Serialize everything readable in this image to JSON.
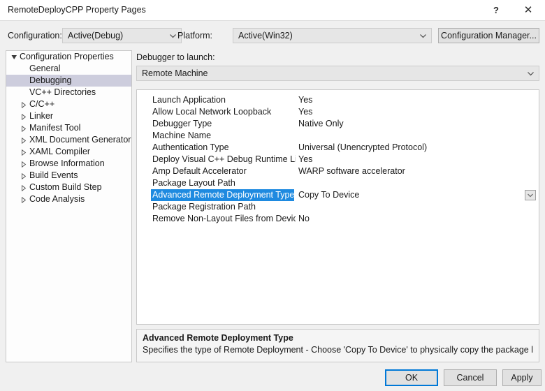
{
  "window": {
    "title": "RemoteDeployCPP Property Pages",
    "help_glyph": "?",
    "close_glyph": "✕"
  },
  "toolbar": {
    "configuration_label": "Configuration:",
    "configuration_value": "Active(Debug)",
    "platform_label": "Platform:",
    "platform_value": "Active(Win32)",
    "config_manager_label": "Configuration Manager..."
  },
  "tree": {
    "items": [
      {
        "label": "Configuration Properties",
        "level": "root",
        "expander": "expanded",
        "selected": false
      },
      {
        "label": "General",
        "level": "child",
        "expander": "none",
        "selected": false
      },
      {
        "label": "Debugging",
        "level": "child",
        "expander": "none",
        "selected": true
      },
      {
        "label": "VC++ Directories",
        "level": "child",
        "expander": "none",
        "selected": false
      },
      {
        "label": "C/C++",
        "level": "group",
        "expander": "collapsed",
        "selected": false
      },
      {
        "label": "Linker",
        "level": "group",
        "expander": "collapsed",
        "selected": false
      },
      {
        "label": "Manifest Tool",
        "level": "group",
        "expander": "collapsed",
        "selected": false
      },
      {
        "label": "XML Document Generator",
        "level": "group",
        "expander": "collapsed",
        "selected": false
      },
      {
        "label": "XAML Compiler",
        "level": "group",
        "expander": "collapsed",
        "selected": false
      },
      {
        "label": "Browse Information",
        "level": "group",
        "expander": "collapsed",
        "selected": false
      },
      {
        "label": "Build Events",
        "level": "group",
        "expander": "collapsed",
        "selected": false
      },
      {
        "label": "Custom Build Step",
        "level": "group",
        "expander": "collapsed",
        "selected": false
      },
      {
        "label": "Code Analysis",
        "level": "group",
        "expander": "collapsed",
        "selected": false
      }
    ]
  },
  "main": {
    "debugger_label": "Debugger to launch:",
    "debugger_value": "Remote Machine",
    "properties": [
      {
        "name": "Launch Application",
        "value": "Yes",
        "selected": false
      },
      {
        "name": "Allow Local Network Loopback",
        "value": "Yes",
        "selected": false
      },
      {
        "name": "Debugger Type",
        "value": "Native Only",
        "selected": false
      },
      {
        "name": "Machine Name",
        "value": "",
        "selected": false
      },
      {
        "name": "Authentication Type",
        "value": "Universal (Unencrypted Protocol)",
        "selected": false
      },
      {
        "name": "Deploy Visual C++ Debug Runtime Librari",
        "value": "Yes",
        "selected": false
      },
      {
        "name": "Amp Default Accelerator",
        "value": "WARP software accelerator",
        "selected": false
      },
      {
        "name": "Package Layout Path",
        "value": "",
        "selected": false
      },
      {
        "name": "Advanced Remote Deployment Type",
        "value": "Copy To Device",
        "selected": true
      },
      {
        "name": "Package Registration Path",
        "value": "",
        "selected": false
      },
      {
        "name": "Remove Non-Layout Files from Device",
        "value": "No",
        "selected": false
      }
    ]
  },
  "description": {
    "title": "Advanced Remote Deployment Type",
    "text": "Specifies the type of Remote Deployment - Choose 'Copy To Device' to physically copy the package layout to re..."
  },
  "footer": {
    "ok_label": "OK",
    "cancel_label": "Cancel",
    "apply_label": "Apply"
  },
  "colors": {
    "selection_blue": "#1e8ae0",
    "tree_selection": "#cdcddd",
    "focus_border": "#0078d7",
    "dialog_bg": "#f0f0f0"
  }
}
